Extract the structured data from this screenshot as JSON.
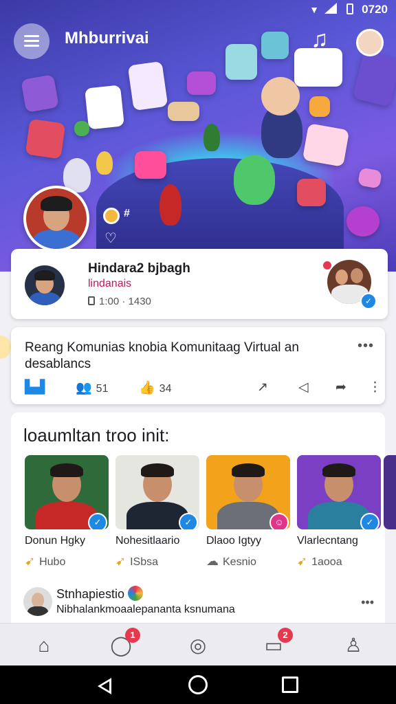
{
  "status": {
    "time": "0720"
  },
  "app": {
    "title": "Mhburrivai"
  },
  "hero": {
    "tag": "#",
    "colors": {
      "top": "#3b3aa6",
      "glow": "#7fe9ff"
    }
  },
  "profile": {
    "name": "Hindara2 bjbagh",
    "handle": "lindanais",
    "stats": "1:00 · 1430"
  },
  "post": {
    "title": "Reang Komunias knobia Komunitaag Virtual an desablancs",
    "actions": [
      {
        "icon": "chart-icon",
        "label": ""
      },
      {
        "icon": "people-icon",
        "label": "51"
      },
      {
        "icon": "like-icon",
        "label": "34"
      }
    ]
  },
  "section": {
    "title": "loaumltan troo init:",
    "members": [
      {
        "name": "Donun Hgky",
        "tag": "Hubo",
        "tag_icon": "rocket-icon",
        "badge_color": "#1e88e5",
        "bg": "#2f6b3a",
        "shirt": "#c62828"
      },
      {
        "name": "Nohesitlaario",
        "tag": "ISbsa",
        "tag_icon": "rocket-icon",
        "badge_color": "#1e88e5",
        "bg": "#e6e6e0",
        "shirt": "#1e2533"
      },
      {
        "name": "Dlaoo Igtyy",
        "tag": "Kesnio",
        "tag_icon": "cloud-icon",
        "badge_color": "#e0358a",
        "bg": "#f2a21b",
        "shirt": "#6a6f78"
      },
      {
        "name": "Vlarlecntang",
        "tag": "1aooa",
        "tag_icon": "rocket-icon",
        "badge_color": "#1e88e5",
        "bg": "#7a3fc2",
        "shirt": "#2a7f9e"
      }
    ]
  },
  "comment": {
    "name": "Stnhapiestio",
    "text": "Nibhalankmoaalepananta ksnumana"
  },
  "nav": {
    "items": [
      {
        "name": "home",
        "badge": ""
      },
      {
        "name": "chat",
        "badge": "1"
      },
      {
        "name": "discover",
        "badge": ""
      },
      {
        "name": "messages",
        "badge": "2"
      },
      {
        "name": "profile",
        "badge": ""
      }
    ]
  }
}
